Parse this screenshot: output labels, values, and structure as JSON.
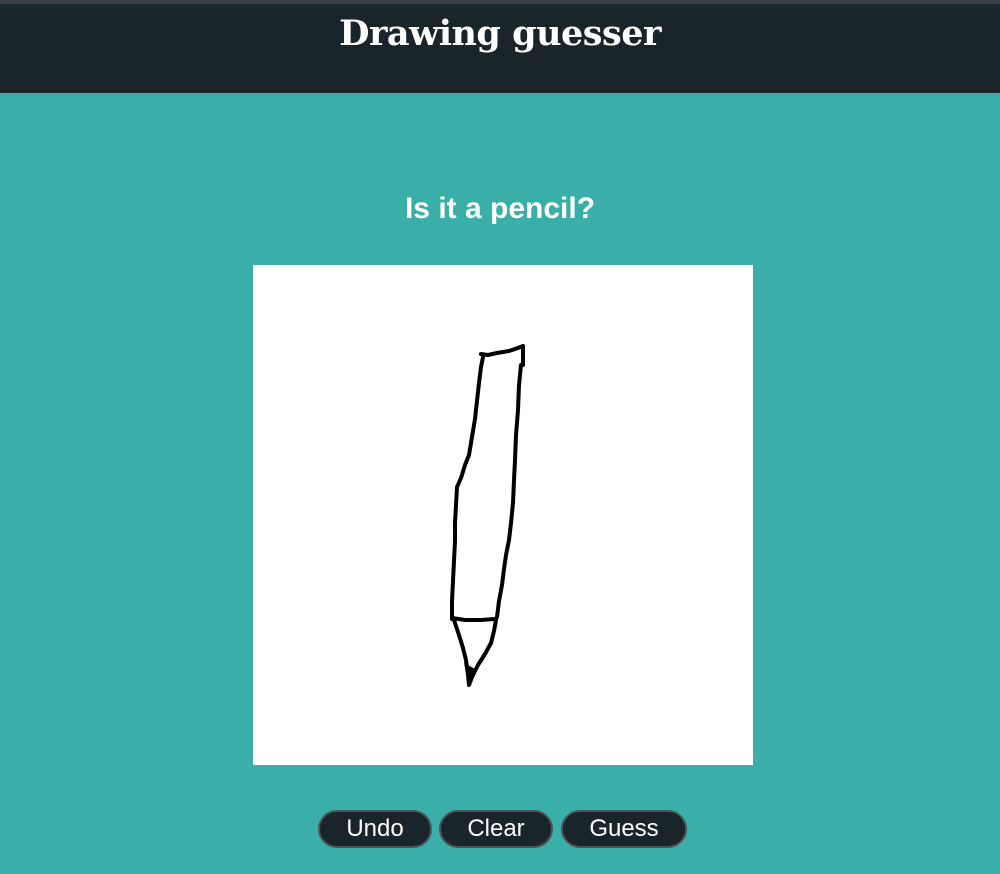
{
  "header": {
    "title": "Drawing guesser"
  },
  "result": {
    "guess_text": "Is it a pencil?"
  },
  "canvas": {
    "background": "#ffffff",
    "stroke_color": "#000000",
    "drawing_subject": "pencil sketch"
  },
  "controls": {
    "undo_label": "Undo",
    "clear_label": "Clear",
    "guess_label": "Guess"
  },
  "theme": {
    "page_background": "#3aafa9",
    "header_background": "#1a252b",
    "button_background": "#1a252b",
    "text_color": "#ffffff"
  }
}
